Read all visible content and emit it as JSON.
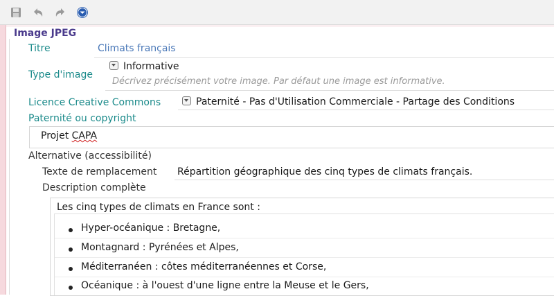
{
  "section": {
    "title": "Image JPEG"
  },
  "fields": {
    "titre": {
      "label": "Titre",
      "value": "Climats français"
    },
    "type_image": {
      "label": "Type d'image",
      "value": "Informative",
      "hint": "Décrivez précisément votre image. Par défaut une image est informative."
    },
    "licence": {
      "label": "Licence Creative Commons",
      "value": "Paternité - Pas d'Utilisation Commerciale - Partage des Conditions"
    },
    "paternite": {
      "label": "Paternité ou copyright",
      "value_part1": "Projet ",
      "value_part2": "CAPA"
    }
  },
  "alternative": {
    "label": "Alternative (accessibilité)",
    "texte_label": "Texte de remplacement",
    "texte_value": "Répartition géographique des cinq types de climats français.",
    "desc_label": "Description complète",
    "desc_intro": "Les cinq types de climats en France sont :",
    "items": [
      "Hyper-océanique : Bretagne,",
      "Montagnard : Pyrénées et Alpes,",
      "Méditerranéen : côtes méditerranéennes et Corse,",
      "Océanique : à l'ouest d'une ligne entre la Meuse et le Gers,"
    ]
  },
  "icons": {
    "save": "save-icon",
    "undo": "undo-icon",
    "redo": "redo-icon",
    "menu": "menu-icon"
  },
  "colors": {
    "label": "#1a8a8a",
    "section": "#4a3a8c",
    "accent": "#2a5db0"
  }
}
